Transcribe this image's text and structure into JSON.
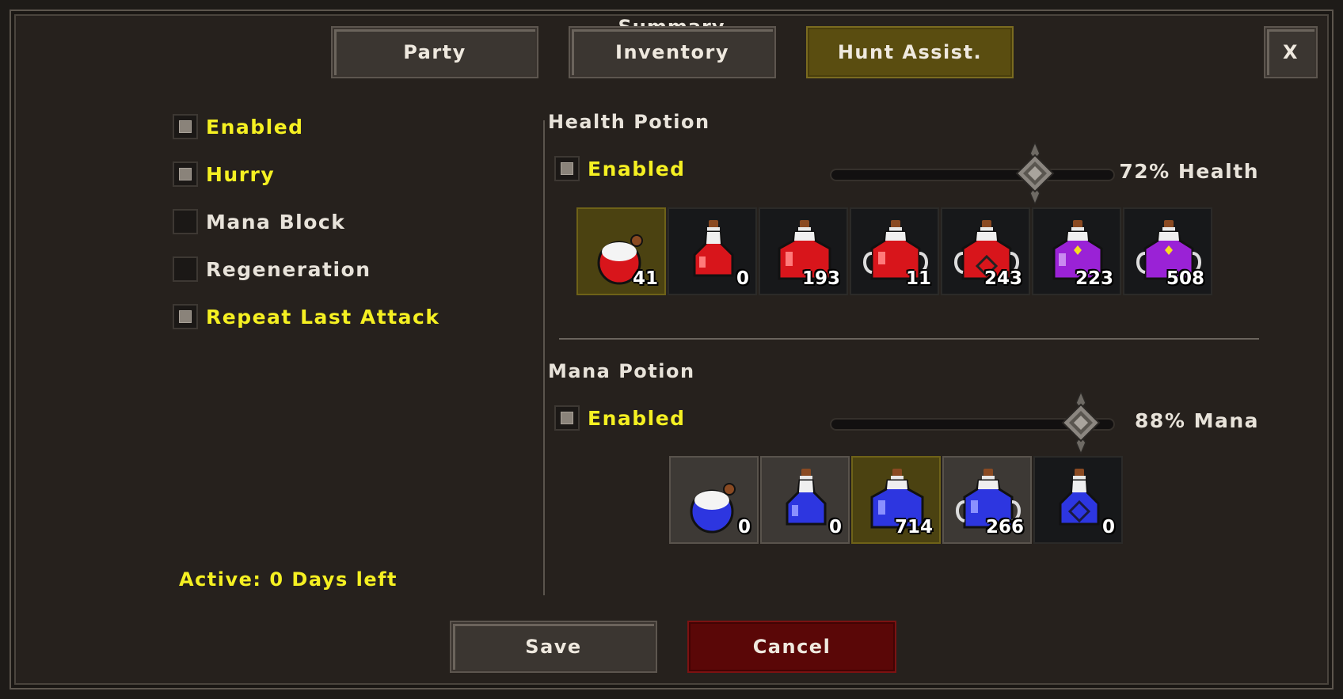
{
  "window": {
    "title": "Summary",
    "close_label": "X"
  },
  "tabs": [
    {
      "label": "Party",
      "active": false
    },
    {
      "label": "Inventory",
      "active": false
    },
    {
      "label": "Hunt Assist.",
      "active": true
    }
  ],
  "options": [
    {
      "label": "Enabled",
      "checked": true
    },
    {
      "label": "Hurry",
      "checked": true
    },
    {
      "label": "Mana Block",
      "checked": false
    },
    {
      "label": "Regeneration",
      "checked": false
    },
    {
      "label": "Repeat Last Attack",
      "checked": true
    }
  ],
  "status": {
    "active_text": "Active: 0 Days left"
  },
  "health_potion": {
    "title": "Health Potion",
    "enabled_label": "Enabled",
    "enabled": true,
    "slider_percent": 72,
    "slider_label": "72% Health",
    "potions": [
      {
        "icon": "small-health-potion-icon",
        "count": "41",
        "selected": true
      },
      {
        "icon": "health-potion-icon",
        "count": "0",
        "selected": false
      },
      {
        "icon": "strong-health-potion-icon",
        "count": "193",
        "selected": false
      },
      {
        "icon": "great-health-potion-icon",
        "count": "11",
        "selected": false
      },
      {
        "icon": "ultimate-health-potion-icon",
        "count": "243",
        "selected": false
      },
      {
        "icon": "great-spirit-potion-icon",
        "count": "223",
        "selected": false
      },
      {
        "icon": "ultimate-spirit-potion-icon",
        "count": "508",
        "selected": false
      }
    ]
  },
  "mana_potion": {
    "title": "Mana Potion",
    "enabled_label": "Enabled",
    "enabled": true,
    "slider_percent": 88,
    "slider_label": "88% Mana",
    "potions": [
      {
        "icon": "small-mana-potion-icon",
        "count": "0",
        "selected": false
      },
      {
        "icon": "mana-potion-icon",
        "count": "0",
        "selected": false
      },
      {
        "icon": "strong-mana-potion-icon",
        "count": "714",
        "selected": true
      },
      {
        "icon": "great-mana-potion-icon",
        "count": "266",
        "selected": false
      },
      {
        "icon": "ultimate-mana-potion-icon",
        "count": "0",
        "selected": false
      }
    ]
  },
  "buttons": {
    "save_label": "Save",
    "cancel_label": "Cancel"
  },
  "colors": {
    "highlight_text": "#f5f022",
    "health_red": "#d8151b",
    "spirit_purple": "#9a22d6",
    "mana_blue": "#2d36e0",
    "selected_slot": "#4b4211",
    "cancel_red": "#5a0707"
  }
}
